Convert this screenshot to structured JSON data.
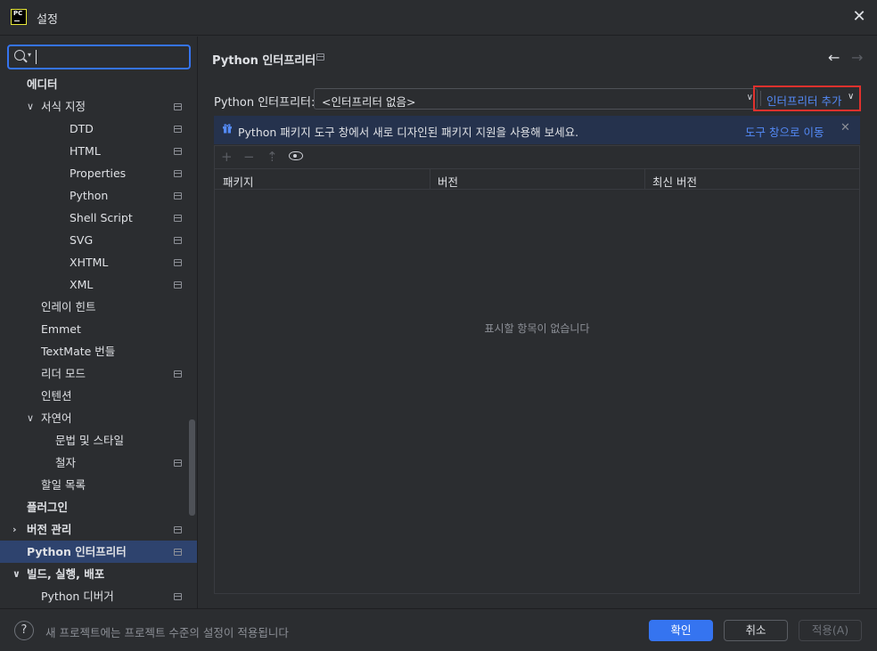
{
  "window": {
    "title": "설정",
    "app_logo": "PC"
  },
  "search": {
    "value": ""
  },
  "sidebar": {
    "items": [
      {
        "label": "에디터",
        "level": 0,
        "bold": true
      },
      {
        "label": "서식 지정",
        "level": 1,
        "expanded": true,
        "project_scope": true
      },
      {
        "label": "DTD",
        "level": 3,
        "project_scope": true
      },
      {
        "label": "HTML",
        "level": 3,
        "project_scope": true
      },
      {
        "label": "Properties",
        "level": 3,
        "project_scope": true
      },
      {
        "label": "Python",
        "level": 3,
        "project_scope": true
      },
      {
        "label": "Shell Script",
        "level": 3,
        "project_scope": true
      },
      {
        "label": "SVG",
        "level": 3,
        "project_scope": true
      },
      {
        "label": "XHTML",
        "level": 3,
        "project_scope": true
      },
      {
        "label": "XML",
        "level": 3,
        "project_scope": true
      },
      {
        "label": "인레이 힌트",
        "level": 1
      },
      {
        "label": "Emmet",
        "level": 1
      },
      {
        "label": "TextMate 번들",
        "level": 1
      },
      {
        "label": "리더 모드",
        "level": 1,
        "project_scope": true
      },
      {
        "label": "인텐션",
        "level": 1
      },
      {
        "label": "자연어",
        "level": 1,
        "expanded": true
      },
      {
        "label": "문법 및 스타일",
        "level": 2
      },
      {
        "label": "철자",
        "level": 2,
        "project_scope": true
      },
      {
        "label": "할일 목록",
        "level": 1
      },
      {
        "label": "플러그인",
        "level": 0,
        "bold": true
      },
      {
        "label": "버전 관리",
        "level": 0,
        "bold": true,
        "expanded": false,
        "project_scope": true
      },
      {
        "label": "Python 인터프리터",
        "level": 0,
        "bold": true,
        "selected": true,
        "project_scope": true
      },
      {
        "label": "빌드, 실행, 배포",
        "level": 0,
        "bold": true,
        "expanded": true
      },
      {
        "label": "Python 디버거",
        "level": 1,
        "project_scope": true
      }
    ]
  },
  "main": {
    "breadcrumb": "Python 인터프리터",
    "interpreter_label": "Python 인터프리터:",
    "interpreter_value": "<인터프리터 없음>",
    "add_interpreter": "인터프리터 추가",
    "banner": {
      "text": "Python 패키지 도구 창에서 새로 디자인된 패키지 지원을 사용해 보세요.",
      "link": "도구 창으로 이동"
    },
    "table": {
      "columns": [
        "패키지",
        "버전",
        "최신 버전"
      ],
      "empty_text": "표시할 항목이 없습니다"
    }
  },
  "footer": {
    "note": "새 프로젝트에는 프로젝트 수준의 설정이 적용됩니다",
    "ok": "확인",
    "cancel": "취소",
    "apply": "적용(A)"
  },
  "colors": {
    "background": "#2b2d30",
    "accent": "#3574f0",
    "link": "#548af7",
    "selection": "#2e436e",
    "highlight_box": "#e0312d"
  }
}
